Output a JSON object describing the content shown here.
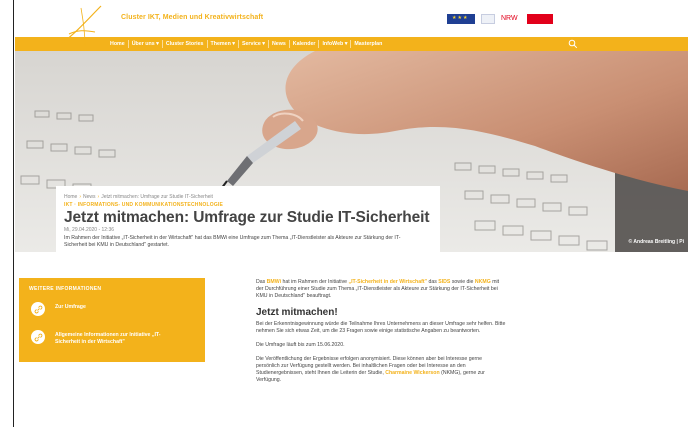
{
  "header": {
    "cluster_title": "Cluster IKT, Medien und Kreativwirtschaft",
    "nrw_logo": "NRW"
  },
  "nav": {
    "items": [
      {
        "label": "Home"
      },
      {
        "label": "Über uns ▾"
      },
      {
        "label": "Cluster Stories"
      },
      {
        "label": "Themen ▾"
      },
      {
        "label": "Service ▾"
      },
      {
        "label": "News"
      },
      {
        "label": "Kalender"
      },
      {
        "label": "InfoWeb ▾"
      },
      {
        "label": "Masterplan"
      }
    ]
  },
  "hero": {
    "photo_credit": "© Andreas Breitling | Pi",
    "breadcrumb": [
      "Home",
      "News",
      "Jetzt mitmachen: Umfrage zur Studie IT-Sicherheit"
    ],
    "category": "IKT · INFORMATIONS- UND KOMMUNIKATIONSTECHNOLOGIE",
    "title": "Jetzt mitmachen: Umfrage zur Studie IT-Sicherheit",
    "date": "Mi, 29.04.2020 - 12:36",
    "teaser": "Im Rahmen der Initiative „IT-Sicherheit in der Wirtschaft\" hat das BMWi eine Umfrage zum Thema „IT-Dienstleister als Akteure zur Stärkung der IT-Sicherheit bei KMU in Deutschland\" gestartet."
  },
  "sidebar": {
    "heading": "WEITERE INFORMATIONEN",
    "links": [
      {
        "label": "Zur Umfrage"
      },
      {
        "label": "Allgemeine Informationen zur Initiative „IT-Sicherheit in der Wirtschaft\""
      }
    ]
  },
  "article": {
    "intro": {
      "p1": "Das ",
      "bmwi": "BMWi",
      "p2": " hat im Rahmen der Initiative ",
      "initiative": "„IT-Sicherheit in der Wirtschaft\"",
      "p3": " das ",
      "sids": "SIDS",
      "p4": " sowie die ",
      "nkmg": "NKMG",
      "p5": " mit der Durchführung einer Studie zum Thema „IT-Dienstleister als Akteure zur Stärkung der IT-Sicherheit bei KMU in Deutschland\" beauftragt."
    },
    "heading": "Jetzt mitmachen!",
    "para2": "Bei der Erkenntnisgewinnung würde die Teilnahme Ihres Unternehmens an dieser Umfrage sehr helfen. Bitte nehmen Sie sich etwas Zeit, um die 23 Fragen sowie einige statistische Angaben zu beantworten.",
    "para3": "Die Umfrage läuft bis zum 15.06.2020.",
    "para4": {
      "p1": "Die Veröffentlichung der Ergebnisse erfolgen anonymisiert. Diese können aber bei Interesse gerne persönlich zur Verfügung gestellt werden. Bei inhaltlichen Fragen oder bei Interesse an den Studienergebnissen, steht Ihnen die Leiterin der Studie, ",
      "contact": "Charmaine Wickerson",
      "p2": " (NKMG), gerne zur Verfügung."
    }
  },
  "colors": {
    "accent": "#f3b21b",
    "eu_blue": "#1f3f93",
    "brand_red": "#e2001a"
  }
}
